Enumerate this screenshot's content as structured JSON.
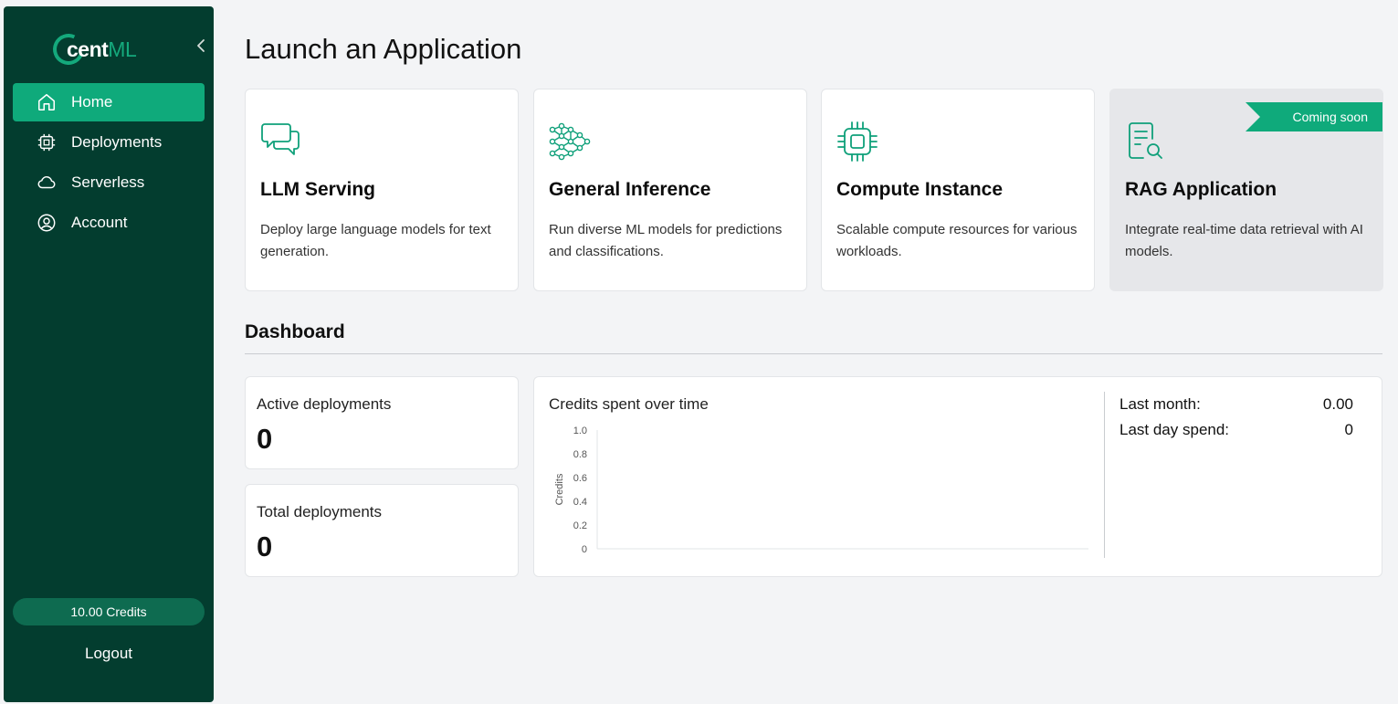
{
  "brand": {
    "part1": "cent",
    "part2": "ML"
  },
  "sidebar": {
    "items": [
      {
        "label": "Home",
        "icon": "home-icon",
        "active": true
      },
      {
        "label": "Deployments",
        "icon": "chip-icon",
        "active": false
      },
      {
        "label": "Serverless",
        "icon": "cloud-icon",
        "active": false
      },
      {
        "label": "Account",
        "icon": "user-circle-icon",
        "active": false
      }
    ],
    "credits": "10.00 Credits",
    "logout": "Logout"
  },
  "main": {
    "title": "Launch an Application",
    "cards": [
      {
        "title": "LLM Serving",
        "desc": "Deploy large language models for text generation.",
        "icon": "chat-bubbles-icon"
      },
      {
        "title": "General Inference",
        "desc": "Run diverse ML models for predictions and classifications.",
        "icon": "neural-network-icon"
      },
      {
        "title": "Compute Instance",
        "desc": "Scalable compute resources for various workloads.",
        "icon": "cpu-icon"
      },
      {
        "title": "RAG Application",
        "desc": "Integrate real-time data retrieval with AI models.",
        "icon": "document-search-icon",
        "badge": "Coming soon"
      }
    ],
    "dashboard": {
      "title": "Dashboard",
      "active_label": "Active deployments",
      "active_value": "0",
      "total_label": "Total deployments",
      "total_value": "0",
      "chart_title": "Credits spent over time",
      "last_month_label": "Last month:",
      "last_month_value": "0.00",
      "last_day_label": "Last day spend:",
      "last_day_value": "0"
    }
  },
  "colors": {
    "sidebar_bg": "#033d2f",
    "accent": "#0faa7b",
    "page_bg": "#f3f4f6"
  },
  "chart_data": {
    "type": "line",
    "title": "Credits spent over time",
    "ylabel": "Credits",
    "xlabel": "",
    "ylim": [
      0,
      1
    ],
    "yticks": [
      "0",
      "0.2",
      "0.4",
      "0.6",
      "0.8",
      "1.0"
    ],
    "series": [],
    "grid": false
  }
}
